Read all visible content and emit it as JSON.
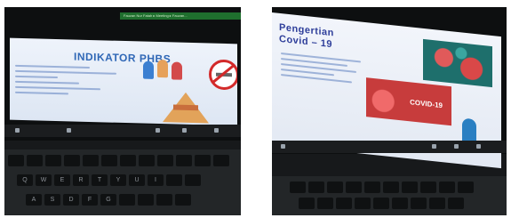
{
  "photos": [
    {
      "banner_text": "Fauzan Nur Fatah ▸ Meeting ▸ Fauzan...",
      "slide_title": "INDIKATOR PHBS",
      "keyboard_rows": [
        [
          "",
          "",
          "",
          "",
          "",
          "",
          "",
          "",
          "",
          "",
          "",
          "",
          ""
        ],
        [
          "Q",
          "W",
          "E",
          "R",
          "T",
          "Y",
          "U",
          "I",
          ""
        ],
        [
          "A",
          "S",
          "D",
          "F",
          "G",
          "",
          "",
          "",
          ""
        ]
      ]
    },
    {
      "slide_title_line1": "Pengertian",
      "slide_title_line2": "Covid – 19",
      "image_caption": "COVID-19"
    }
  ]
}
